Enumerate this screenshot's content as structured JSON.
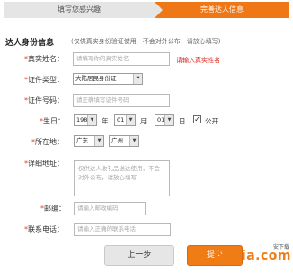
{
  "steps": {
    "step1": "填写您感兴趣",
    "step2": "完善达人信息"
  },
  "section": {
    "title": "达人身份信息",
    "note": "(仅供真实身份验证使用，不会对外公布，请放心填写)"
  },
  "fields": {
    "real_name": {
      "label": "真实姓名：",
      "placeholder": "请填写你的真实姓名",
      "error": "请输入真实姓名"
    },
    "id_type": {
      "label": "证件类型：",
      "value": "大陆居民身份证"
    },
    "id_number": {
      "label": "证件号码：",
      "placeholder": "请正确填写证件号码"
    },
    "birthday": {
      "label": "生日：",
      "year": "1980",
      "year_unit": "年",
      "month": "01",
      "month_unit": "月",
      "day": "01",
      "day_unit": "日",
      "public_label": "公开",
      "public_checked": true
    },
    "location": {
      "label": "所在地：",
      "province": "广东",
      "city": "广州"
    },
    "address": {
      "label": "详细地址：",
      "placeholder": "仅供达人收礼品送达使用，不会对外公布，请放心填写"
    },
    "postcode": {
      "label": "邮编：",
      "placeholder": "请输入邮政编码"
    },
    "phone": {
      "label": "联系电话：",
      "placeholder": "请输入正确的联系电话"
    }
  },
  "actions": {
    "prev": "上一步",
    "next": "提交"
  },
  "watermark": {
    "text": "Anxia.com",
    "sub": "安下载"
  }
}
